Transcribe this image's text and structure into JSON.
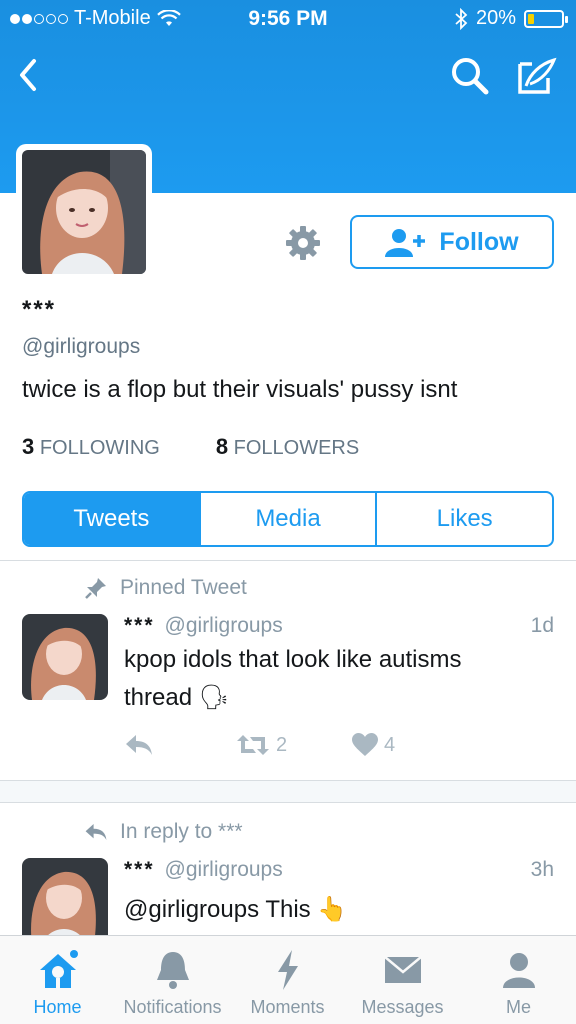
{
  "status_bar": {
    "carrier": "T-Mobile",
    "time": "9:56 PM",
    "battery": "20%",
    "battery_level": 0.2,
    "signal_bars_filled": 2,
    "signal_bars_total": 5
  },
  "nav": {
    "back_icon": "chevron-left-icon",
    "search_icon": "search-icon",
    "compose_icon": "compose-icon"
  },
  "profile": {
    "name": "***",
    "handle": "@girligroups",
    "bio": "twice is a flop but their visuals' pussy isnt",
    "following_count": "3",
    "following_label": "FOLLOWING",
    "followers_count": "8",
    "followers_label": "FOLLOWERS",
    "follow_label": "Follow",
    "settings_icon": "gear-icon"
  },
  "tabs": [
    {
      "label": "Tweets",
      "active": true
    },
    {
      "label": "Media",
      "active": false
    },
    {
      "label": "Likes",
      "active": false
    }
  ],
  "tweets": [
    {
      "context": "Pinned Tweet",
      "context_icon": "pin-icon",
      "name": "***",
      "handle": "@girligroups",
      "time": "1d",
      "text_line1": "kpop idols that look like autisms",
      "text_line2": "thread",
      "emoji": "🗣",
      "retweets": "2",
      "likes": "4"
    },
    {
      "context": "In reply to ***",
      "context_icon": "reply-icon",
      "name": "***",
      "handle": "@girligroups",
      "time": "3h",
      "text": "@girligroups This",
      "emoji": "👆"
    }
  ],
  "tabbar": [
    {
      "label": "Home",
      "icon": "home-icon",
      "active": true
    },
    {
      "label": "Notifications",
      "icon": "bell-icon",
      "active": false
    },
    {
      "label": "Moments",
      "icon": "lightning-icon",
      "active": false
    },
    {
      "label": "Messages",
      "icon": "envelope-icon",
      "active": false
    },
    {
      "label": "Me",
      "icon": "person-icon",
      "active": false
    }
  ],
  "colors": {
    "accent": "#1d9bf0",
    "muted": "#8899a6",
    "text": "#14171a"
  }
}
